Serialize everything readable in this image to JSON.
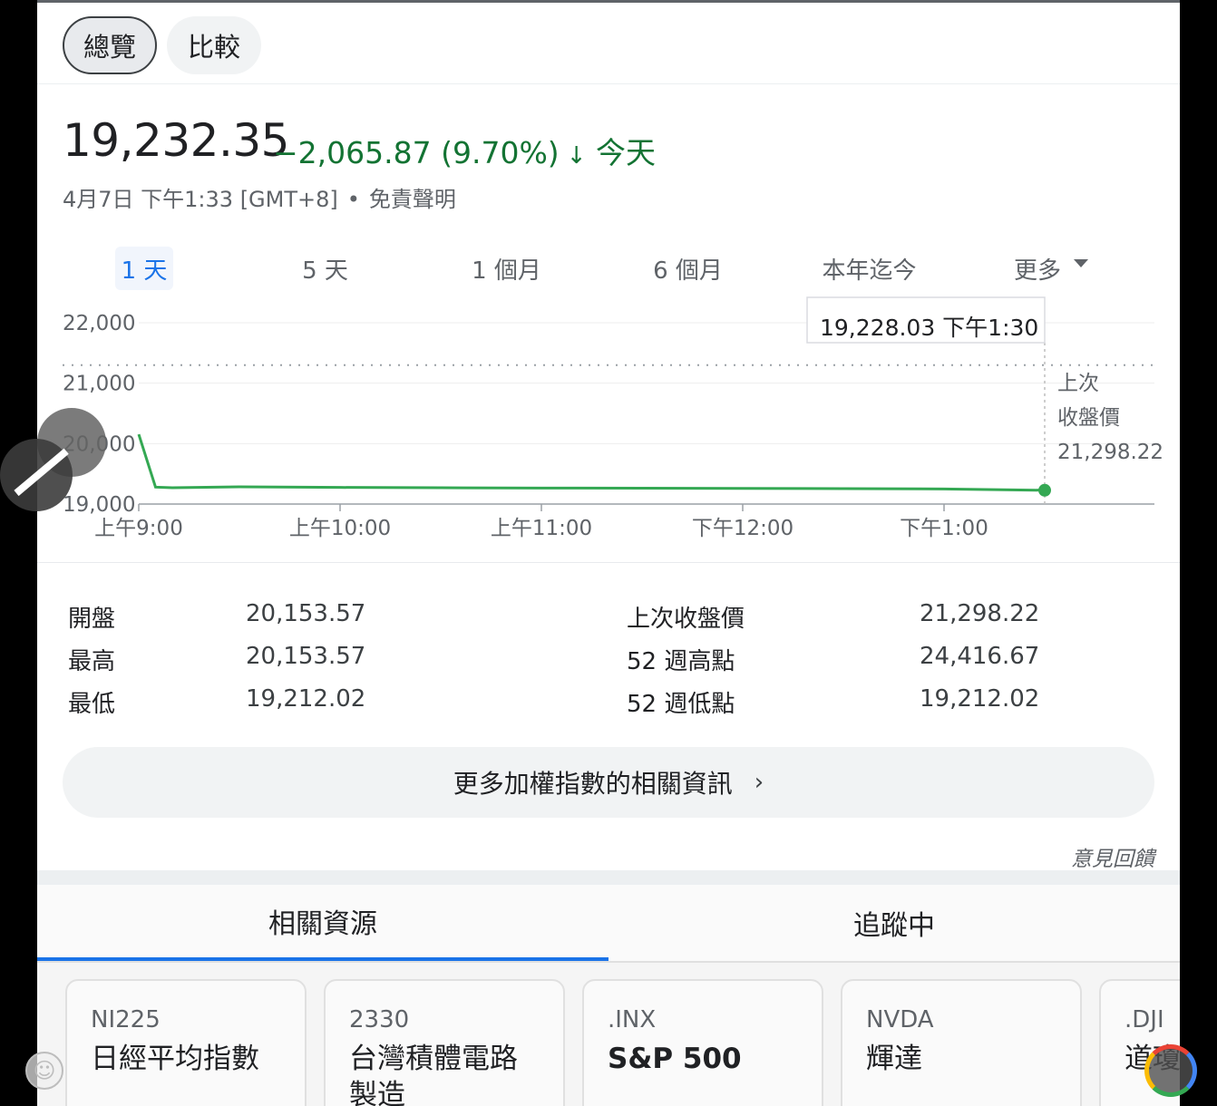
{
  "header_tabs": {
    "overview": "總覽",
    "compare": "比較"
  },
  "quote": {
    "price": "19,232.35",
    "change": "−2,065.87 (9.70%)",
    "arrow": "↓",
    "period": "今天",
    "datetime": "4月7日 下午1:33 [GMT+8]",
    "separator": "•",
    "disclaimer": "免責聲明"
  },
  "ranges": [
    "1 天",
    "5 天",
    "1 個月",
    "6 個月",
    "本年迄今",
    "更多"
  ],
  "tooltip": {
    "value": "19,228.03",
    "time": "下午1:30"
  },
  "previous_close_label_line1": "上次",
  "previous_close_label_line2": "收盤價",
  "previous_close_value": "21,298.22",
  "chart_data": {
    "type": "line",
    "y_ticks": [
      "22,000",
      "21,000",
      "20,000",
      "19,000"
    ],
    "x_ticks": [
      "上午9:00",
      "上午10:00",
      "上午11:00",
      "下午12:00",
      "下午1:00"
    ],
    "ylim": [
      19000,
      22000
    ],
    "previous_close": 21298.22,
    "series": [
      {
        "x": [
          "09:00",
          "09:05",
          "09:10",
          "09:30",
          "10:00",
          "10:30",
          "11:00",
          "11:30",
          "12:00",
          "12:30",
          "13:00",
          "13:30"
        ],
        "values": [
          20153.57,
          19280,
          19270,
          19285,
          19275,
          19270,
          19265,
          19262,
          19258,
          19255,
          19250,
          19228.03
        ]
      }
    ],
    "color": "#34a853"
  },
  "stats": {
    "left": [
      {
        "label": "開盤",
        "value": "20,153.57"
      },
      {
        "label": "最高",
        "value": "20,153.57"
      },
      {
        "label": "最低",
        "value": "19,212.02"
      }
    ],
    "right": [
      {
        "label": "上次收盤價",
        "value": "21,298.22"
      },
      {
        "label": "52 週高點",
        "value": "24,416.67"
      },
      {
        "label": "52 週低點",
        "value": "19,212.02"
      }
    ]
  },
  "more_button": "更多加權指數的相關資訊",
  "more_chevron": "›",
  "feedback": "意見回饋",
  "bottom_tabs": {
    "related": "相關資源",
    "following": "追蹤中"
  },
  "cards": [
    {
      "symbol": "NI225",
      "name": "日經平均指數"
    },
    {
      "symbol": "2330",
      "name": "台灣積體電路製造"
    },
    {
      "symbol": ".INX",
      "name": "S&P 500"
    },
    {
      "symbol": "NVDA",
      "name": "輝達"
    },
    {
      "symbol": ".DJI",
      "name": "道瓊指數"
    }
  ],
  "smile_icon": "☺"
}
